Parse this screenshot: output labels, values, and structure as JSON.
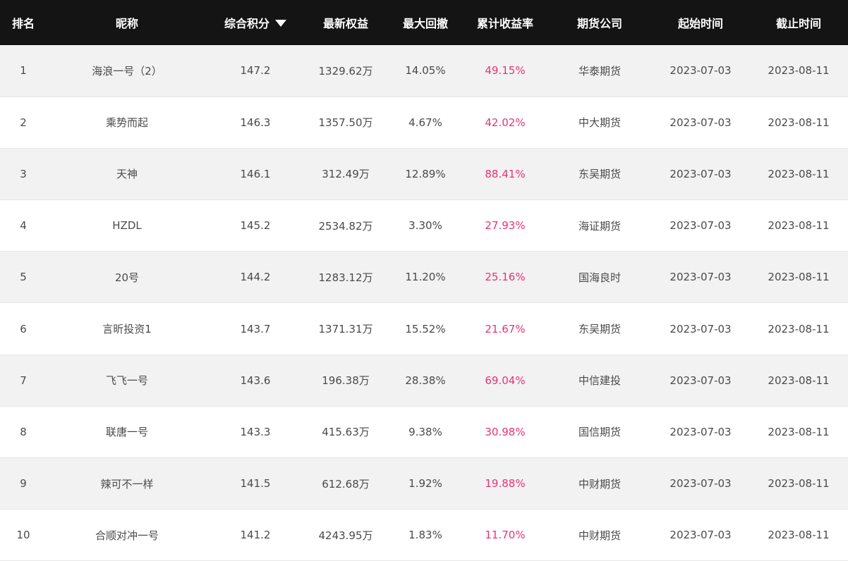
{
  "header": {
    "columns": [
      "排名",
      "昵称",
      "综合积分",
      "最新权益",
      "最大回撤",
      "累计收益率",
      "期货公司",
      "起始时间",
      "截止时间"
    ],
    "sort_icon": "caret-down-icon"
  },
  "colors": {
    "header_bg": "#141414",
    "row_odd_bg": "#f2f2f2",
    "row_even_bg": "#ffffff",
    "profit_text": "#e8327a",
    "body_text": "#4a4a4a"
  },
  "rows": [
    [
      "1",
      "海浪一号（2）",
      "147.2",
      "1329.62万",
      "14.05%",
      "49.15%",
      "华泰期货",
      "2023-07-03",
      "2023-08-11"
    ],
    [
      "2",
      "乘势而起",
      "146.3",
      "1357.50万",
      "4.67%",
      "42.02%",
      "中大期货",
      "2023-07-03",
      "2023-08-11"
    ],
    [
      "3",
      "天神",
      "146.1",
      "312.49万",
      "12.89%",
      "88.41%",
      "东吴期货",
      "2023-07-03",
      "2023-08-11"
    ],
    [
      "4",
      "HZDL",
      "145.2",
      "2534.82万",
      "3.30%",
      "27.93%",
      "海证期货",
      "2023-07-03",
      "2023-08-11"
    ],
    [
      "5",
      "20号",
      "144.2",
      "1283.12万",
      "11.20%",
      "25.16%",
      "国海良时",
      "2023-07-03",
      "2023-08-11"
    ],
    [
      "6",
      "言昕投资1",
      "143.7",
      "1371.31万",
      "15.52%",
      "21.67%",
      "东吴期货",
      "2023-07-03",
      "2023-08-11"
    ],
    [
      "7",
      "飞飞一号",
      "143.6",
      "196.38万",
      "28.38%",
      "69.04%",
      "中信建投",
      "2023-07-03",
      "2023-08-11"
    ],
    [
      "8",
      "联唐一号",
      "143.3",
      "415.63万",
      "9.38%",
      "30.98%",
      "国信期货",
      "2023-07-03",
      "2023-08-11"
    ],
    [
      "9",
      "辣可不一样",
      "141.5",
      "612.68万",
      "1.92%",
      "19.88%",
      "中财期货",
      "2023-07-03",
      "2023-08-11"
    ],
    [
      "10",
      "合顺对冲一号",
      "141.2",
      "4243.95万",
      "1.83%",
      "11.70%",
      "中财期货",
      "2023-07-03",
      "2023-08-11"
    ]
  ]
}
